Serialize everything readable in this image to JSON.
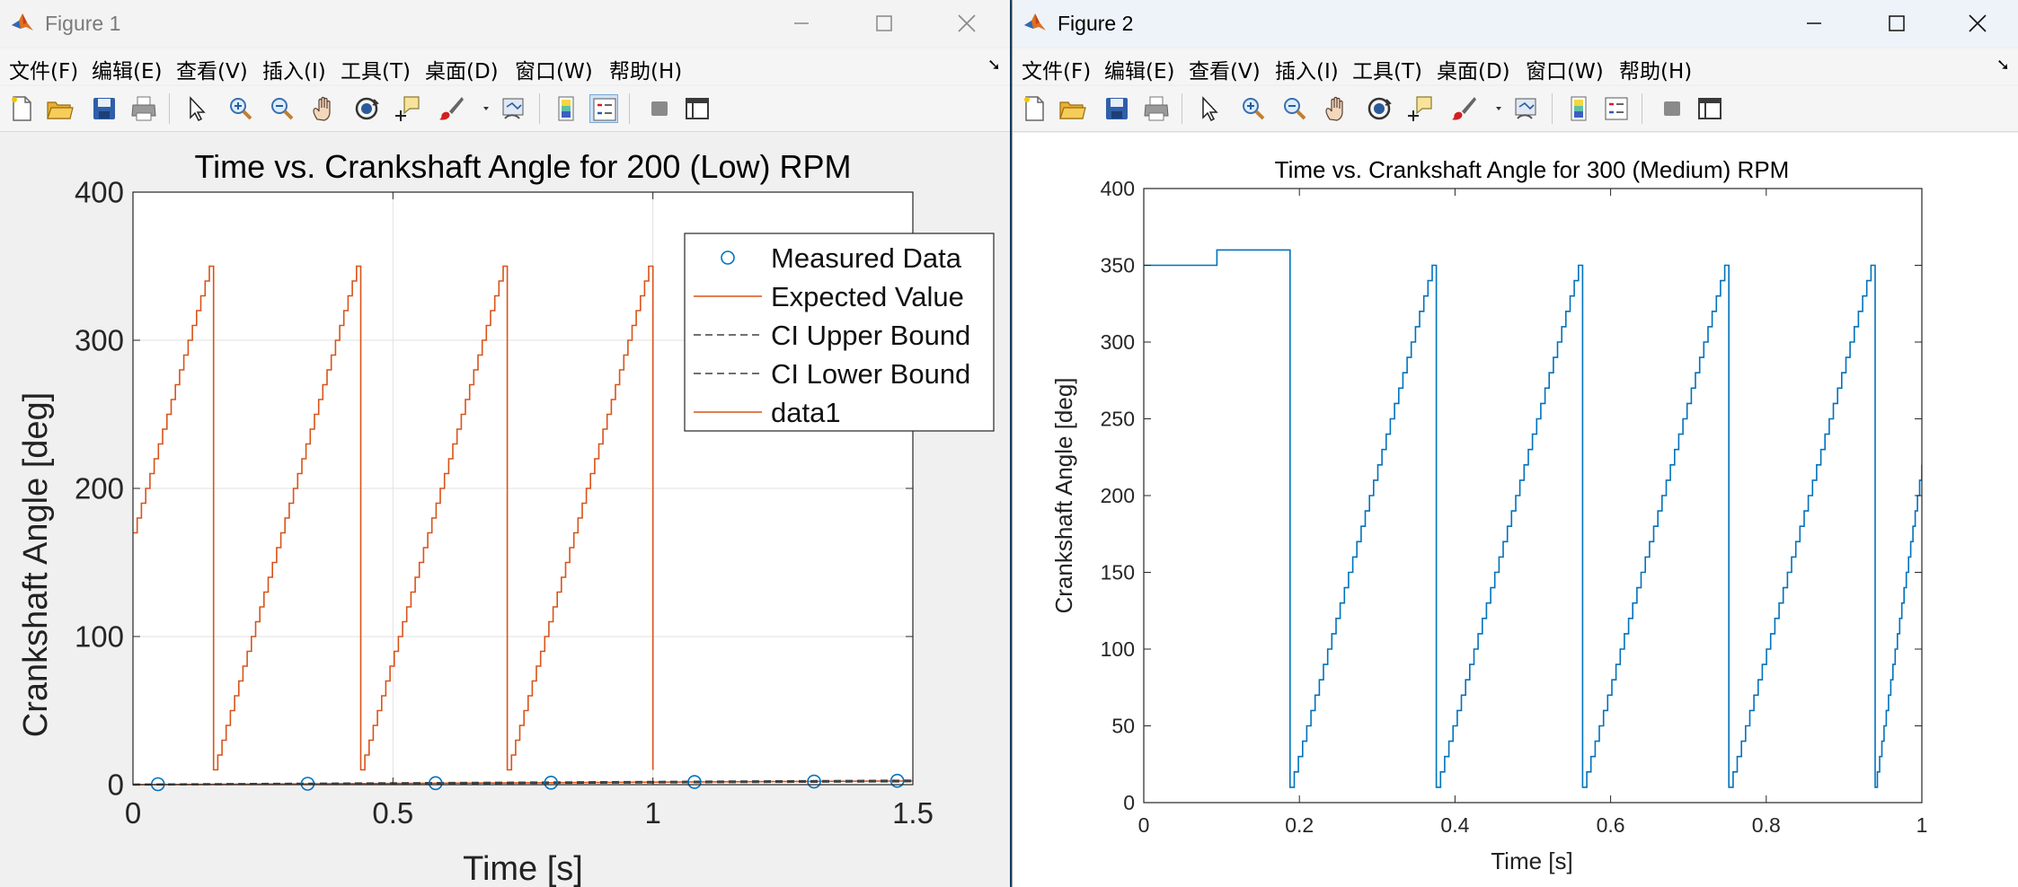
{
  "windows": [
    {
      "title": "Figure 1",
      "menu": [
        "文件(F)",
        "编辑(E)",
        "查看(V)",
        "插入(I)",
        "工具(T)",
        "桌面(D)",
        "窗口(W)",
        "帮助(H)"
      ],
      "toolbar_icons": [
        "new-figure-icon",
        "open-file-icon",
        "save-icon",
        "print-icon",
        "pointer-icon",
        "zoom-in-icon",
        "zoom-out-icon",
        "pan-icon",
        "rotate-3d-icon",
        "data-cursor-icon",
        "brush-icon",
        "brush-dropdown-icon",
        "link-plot-icon",
        "colorbar-icon",
        "legend-icon",
        "hide-plot-tools-icon",
        "show-plot-tools-icon"
      ]
    },
    {
      "title": "Figure 2",
      "menu": [
        "文件(F)",
        "编辑(E)",
        "查看(V)",
        "插入(I)",
        "工具(T)",
        "桌面(D)",
        "窗口(W)",
        "帮助(H)"
      ],
      "toolbar_icons": [
        "new-figure-icon",
        "open-file-icon",
        "save-icon",
        "print-icon",
        "pointer-icon",
        "zoom-in-icon",
        "zoom-out-icon",
        "pan-icon",
        "rotate-3d-icon",
        "data-cursor-icon",
        "brush-icon",
        "brush-dropdown-icon",
        "link-plot-icon",
        "colorbar-icon",
        "legend-icon",
        "hide-plot-tools-icon",
        "show-plot-tools-icon"
      ]
    }
  ],
  "chart_data": [
    {
      "type": "line",
      "title": "Time vs. Crankshaft Angle for 200 (Low) RPM",
      "xlabel": "Time [s]",
      "ylabel": "Crankshaft Angle [deg]",
      "xlim": [
        0,
        1.5
      ],
      "ylim": [
        0,
        400
      ],
      "xticks": [
        "0",
        "0.5",
        "1",
        "1.5"
      ],
      "yticks": [
        "0",
        "100",
        "200",
        "300",
        "400"
      ],
      "grid": true,
      "legend_position": "top-right",
      "legend": [
        "Measured Data",
        "Expected Value",
        "CI Upper Bound",
        "CI Lower Bound",
        "data1"
      ],
      "series": [
        {
          "name": "Measured Data",
          "style": "markers-circle",
          "color": "#0072BD",
          "x": [
            0.048,
            0.336,
            0.582,
            0.804,
            1.08,
            1.31,
            1.47
          ],
          "y": [
            0.3,
            0.6,
            1.0,
            1.3,
            1.8,
            2.1,
            2.6
          ]
        },
        {
          "name": "Expected Value",
          "style": "line",
          "color": "#D95319",
          "x": [
            0,
            1.5
          ],
          "y": [
            0,
            2.5
          ]
        },
        {
          "name": "CI Upper Bound",
          "style": "dashed",
          "color": "#404040",
          "x": [
            0,
            1.5
          ],
          "y": [
            0.3,
            3.0
          ]
        },
        {
          "name": "CI Lower Bound",
          "style": "dashed",
          "color": "#404040",
          "x": [
            0,
            1.5
          ],
          "y": [
            -0.2,
            2.0
          ]
        },
        {
          "name": "data1",
          "style": "staircase-sawtooth",
          "color": "#D95319",
          "start_time": 0,
          "start_angle": 170,
          "drops_at": [
            0.155,
            0.438,
            0.72,
            1.0
          ],
          "min_angle": 10,
          "max_angle": 350,
          "step_deg": 10,
          "end_time": 1.0,
          "end_angle": 30
        }
      ]
    },
    {
      "type": "line",
      "title": "Time vs. Crankshaft Angle for 300 (Medium) RPM",
      "xlabel": "Time [s]",
      "ylabel": "Crankshaft Angle [deg]",
      "xlim": [
        0,
        1
      ],
      "ylim": [
        0,
        400
      ],
      "xticks": [
        "0",
        "0.2",
        "0.4",
        "0.6",
        "0.8",
        "1"
      ],
      "yticks": [
        "0",
        "50",
        "100",
        "150",
        "200",
        "250",
        "300",
        "350",
        "400"
      ],
      "grid": false,
      "series": [
        {
          "style": "staircase-sawtooth",
          "color": "#0072BD",
          "start_time": 0,
          "start_angle": 350,
          "drops_at": [
            0.0,
            0.188,
            0.376,
            0.564,
            0.752,
            0.94
          ],
          "min_angle": 10,
          "max_angle": 350,
          "step_deg": 10,
          "end_time": 1.0,
          "end_angle": 220
        }
      ]
    }
  ]
}
